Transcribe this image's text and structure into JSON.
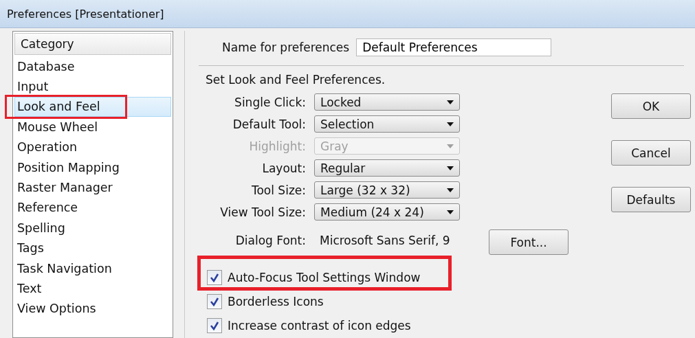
{
  "window": {
    "title": "Preferences [Presentationer]"
  },
  "category_list": {
    "header": "Category",
    "items": [
      {
        "label": "Database",
        "selected": false,
        "highlighted": false
      },
      {
        "label": "Input",
        "selected": false,
        "highlighted": false
      },
      {
        "label": "Look and Feel",
        "selected": true,
        "highlighted": true
      },
      {
        "label": "Mouse Wheel",
        "selected": false,
        "highlighted": false
      },
      {
        "label": "Operation",
        "selected": false,
        "highlighted": false
      },
      {
        "label": "Position Mapping",
        "selected": false,
        "highlighted": false
      },
      {
        "label": "Raster Manager",
        "selected": false,
        "highlighted": false
      },
      {
        "label": "Reference",
        "selected": false,
        "highlighted": false
      },
      {
        "label": "Spelling",
        "selected": false,
        "highlighted": false
      },
      {
        "label": "Tags",
        "selected": false,
        "highlighted": false
      },
      {
        "label": "Task Navigation",
        "selected": false,
        "highlighted": false
      },
      {
        "label": "Text",
        "selected": false,
        "highlighted": false
      },
      {
        "label": "View Options",
        "selected": false,
        "highlighted": false
      }
    ]
  },
  "name_field": {
    "label": "Name for preferences",
    "value": "Default Preferences"
  },
  "section_title": "Set Look and Feel Preferences.",
  "settings": [
    {
      "kind": "dropdown",
      "label": "Single Click:",
      "value": "Locked",
      "disabled": false
    },
    {
      "kind": "dropdown",
      "label": "Default Tool:",
      "value": "Selection",
      "disabled": false
    },
    {
      "kind": "dropdown",
      "label": "Highlight:",
      "value": "Gray",
      "disabled": true
    },
    {
      "kind": "dropdown",
      "label": "Layout:",
      "value": "Regular",
      "disabled": false
    },
    {
      "kind": "dropdown",
      "label": "Tool Size:",
      "value": "Large (32 x 32)",
      "disabled": false
    },
    {
      "kind": "dropdown",
      "label": "View Tool Size:",
      "value": "Medium (24 x 24)",
      "disabled": false
    },
    {
      "kind": "text",
      "label": "Dialog Font:",
      "value": "Microsoft Sans Serif, 9",
      "button": "Font..."
    }
  ],
  "checkboxes": [
    {
      "label": "Auto-Focus Tool Settings Window",
      "checked": true,
      "highlighted": true
    },
    {
      "label": "Borderless Icons",
      "checked": true,
      "highlighted": false
    },
    {
      "label": "Increase contrast of icon edges",
      "checked": true,
      "highlighted": false
    }
  ],
  "buttons": [
    "OK",
    "Cancel",
    "Defaults"
  ]
}
